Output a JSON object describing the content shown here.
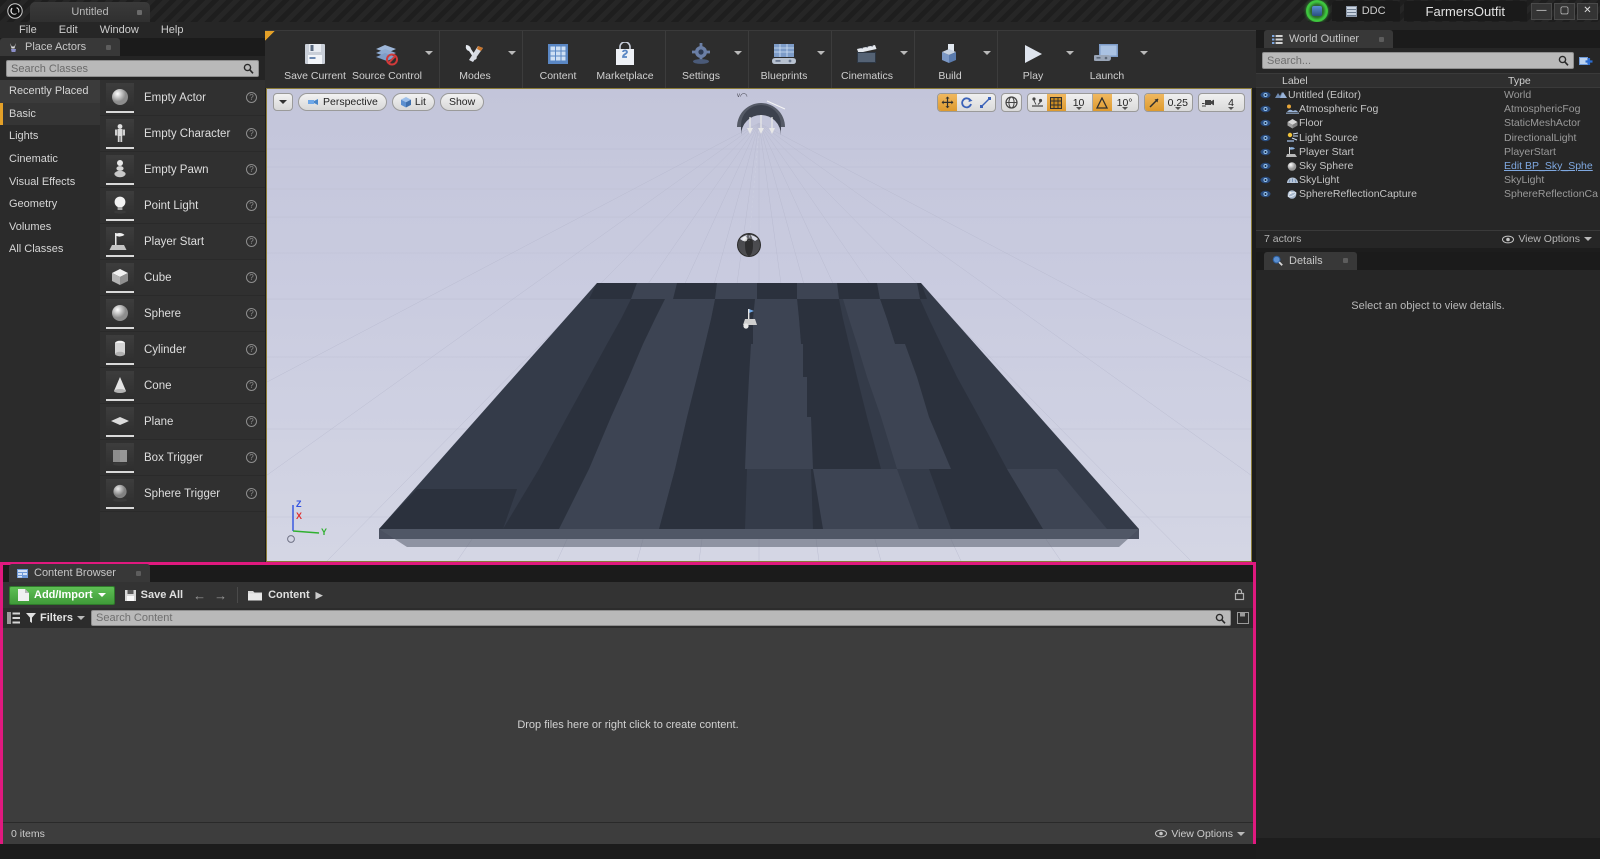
{
  "titlebar": {
    "project_tab": "Untitled",
    "ddc_label": "DDC",
    "project_name": "FarmersOutfit",
    "minimize": "—",
    "maximize": "▢",
    "close": "✕"
  },
  "menubar": {
    "items": [
      "File",
      "Edit",
      "Window",
      "Help"
    ]
  },
  "place_actors": {
    "tab_label": "Place Actors",
    "search_placeholder": "Search Classes",
    "categories": [
      {
        "label": "Recently Placed",
        "state": "recent"
      },
      {
        "label": "Basic",
        "state": "active"
      },
      {
        "label": "Lights",
        "state": ""
      },
      {
        "label": "Cinematic",
        "state": ""
      },
      {
        "label": "Visual Effects",
        "state": ""
      },
      {
        "label": "Geometry",
        "state": ""
      },
      {
        "label": "Volumes",
        "state": ""
      },
      {
        "label": "All Classes",
        "state": ""
      }
    ],
    "actors": [
      {
        "name": "Empty Actor",
        "icon": "sphere-thumb"
      },
      {
        "name": "Empty Character",
        "icon": "character-thumb"
      },
      {
        "name": "Empty Pawn",
        "icon": "pawn-thumb"
      },
      {
        "name": "Point Light",
        "icon": "bulb-thumb"
      },
      {
        "name": "Player Start",
        "icon": "flag-thumb"
      },
      {
        "name": "Cube",
        "icon": "cube-thumb"
      },
      {
        "name": "Sphere",
        "icon": "sphere-thumb"
      },
      {
        "name": "Cylinder",
        "icon": "cylinder-thumb"
      },
      {
        "name": "Cone",
        "icon": "cone-thumb"
      },
      {
        "name": "Plane",
        "icon": "plane-thumb"
      },
      {
        "name": "Box Trigger",
        "icon": "boxtrigger-thumb"
      },
      {
        "name": "Sphere Trigger",
        "icon": "spheretrigger-thumb"
      }
    ]
  },
  "toolbar": {
    "buttons": [
      {
        "label": "Save Current",
        "icon": "floppy-icon",
        "caret": false
      },
      {
        "label": "Source Control",
        "icon": "source-control-icon",
        "caret": true
      },
      {
        "label": "Modes",
        "icon": "modes-icon",
        "caret": true
      },
      {
        "label": "Content",
        "icon": "content-icon",
        "caret": false
      },
      {
        "label": "Marketplace",
        "icon": "marketplace-icon",
        "caret": false
      },
      {
        "label": "Settings",
        "icon": "settings-icon",
        "caret": true
      },
      {
        "label": "Blueprints",
        "icon": "blueprints-icon",
        "caret": true
      },
      {
        "label": "Cinematics",
        "icon": "cinematics-icon",
        "caret": true
      },
      {
        "label": "Build",
        "icon": "build-icon",
        "caret": true
      },
      {
        "label": "Play",
        "icon": "play-icon",
        "caret": true
      },
      {
        "label": "Launch",
        "icon": "launch-icon",
        "caret": true
      }
    ]
  },
  "viewport": {
    "view_menu_caret": "▾",
    "perspective_label": "Perspective",
    "lit_label": "Lit",
    "show_label": "Show",
    "grid_snap_value": "10",
    "angle_snap_value": "10°",
    "scale_snap_value": "0.25",
    "camera_speed_value": "4",
    "axis": {
      "x": "X",
      "y": "Y",
      "z": "Z"
    },
    "axis_colors": {
      "x": "#e03030",
      "y": "#30b030",
      "z": "#3050e0"
    }
  },
  "world_outliner": {
    "tab_label": "World Outliner",
    "search_placeholder": "Search...",
    "columns": {
      "label": "Label",
      "type": "Type"
    },
    "rows": [
      {
        "label": "Untitled (Editor)",
        "type": "World",
        "indent": 0,
        "icon": "world-icon",
        "link": false
      },
      {
        "label": "Atmospheric Fog",
        "type": "AtmosphericFog",
        "indent": 1,
        "icon": "fog-icon",
        "link": false
      },
      {
        "label": "Floor",
        "type": "StaticMeshActor",
        "indent": 1,
        "icon": "mesh-icon",
        "link": false
      },
      {
        "label": "Light Source",
        "type": "DirectionalLight",
        "indent": 1,
        "icon": "dirlight-icon",
        "link": false
      },
      {
        "label": "Player Start",
        "type": "PlayerStart",
        "indent": 1,
        "icon": "playerstart-icon",
        "link": false
      },
      {
        "label": "Sky Sphere",
        "type": "Edit BP_Sky_Sphe",
        "indent": 1,
        "icon": "sphere-icon",
        "link": true
      },
      {
        "label": "SkyLight",
        "type": "SkyLight",
        "indent": 1,
        "icon": "skylight-icon",
        "link": false
      },
      {
        "label": "SphereReflectionCapture",
        "type": "SphereReflectionCa",
        "indent": 1,
        "icon": "reflect-icon",
        "link": false
      }
    ],
    "actor_count": "7 actors",
    "view_options": "View Options"
  },
  "details": {
    "tab_label": "Details",
    "empty_message": "Select an object to view details."
  },
  "content_browser": {
    "tab_label": "Content Browser",
    "add_import": "Add/Import",
    "save_all": "Save All",
    "breadcrumb": "Content",
    "filters": "Filters",
    "search_placeholder": "Search Content",
    "empty_message": "Drop files here or right click to create content.",
    "item_count": "0 items",
    "view_options": "View Options",
    "highlight_color": "#e0197f"
  }
}
